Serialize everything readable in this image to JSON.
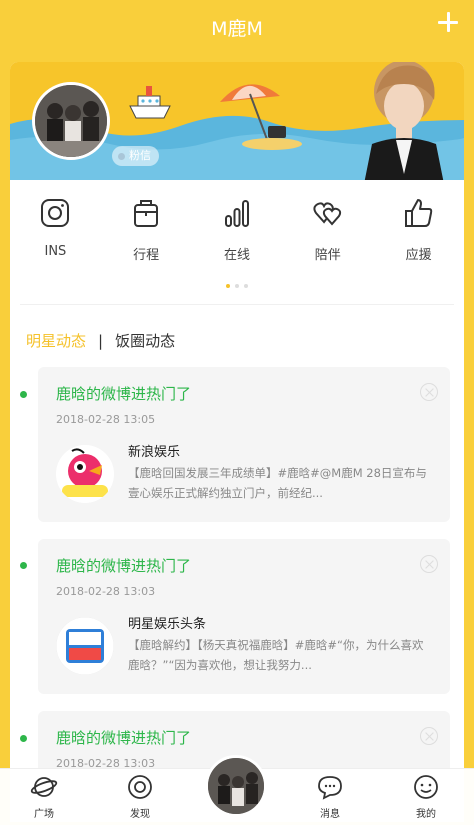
{
  "header": {
    "title": "M鹿M"
  },
  "banner": {
    "fans_badge": "粉信"
  },
  "shortcuts": [
    {
      "label": "INS",
      "icon": "instagram-icon"
    },
    {
      "label": "行程",
      "icon": "luggage-icon"
    },
    {
      "label": "在线",
      "icon": "signal-bars-icon"
    },
    {
      "label": "陪伴",
      "icon": "hearts-icon"
    },
    {
      "label": "应援",
      "icon": "thumbs-up-icon"
    }
  ],
  "tabs": {
    "active": "明星动态",
    "separator": "|",
    "inactive": "饭圈动态"
  },
  "feed": [
    {
      "title": "鹿晗的微博进热门了",
      "time": "2018-02-28 13:05",
      "source": "新浪娱乐",
      "body": "【鹿晗回国发展三年成绩单】#鹿晗#@M鹿M 28日宣布与壹心娱乐正式解约独立门户，前经纪...",
      "thumb": "sina-ent-logo"
    },
    {
      "title": "鹿晗的微博进热门了",
      "time": "2018-02-28 13:03",
      "source": "明星娱乐头条",
      "body": "【鹿晗解约】【杨天真祝福鹿晗】#鹿晗#“你，为什么喜欢鹿晗？”“因为喜欢他，想让我努力...",
      "thumb": "toutiao-ent-logo"
    },
    {
      "title": "鹿晗的微博进热门了",
      "time": "2018-02-28 13:03",
      "source": "",
      "body": "",
      "thumb": ""
    }
  ],
  "bottom_nav": [
    {
      "label": "广场",
      "icon": "planet-icon"
    },
    {
      "label": "发现",
      "icon": "compass-icon"
    },
    {
      "label": "",
      "icon": "avatar-center"
    },
    {
      "label": "消息",
      "icon": "chat-bubble-icon"
    },
    {
      "label": "我的",
      "icon": "face-icon"
    }
  ],
  "colors": {
    "brand_yellow": "#f9cf3b",
    "accent_green": "#2db64a",
    "tab_active": "#f5c22b"
  }
}
